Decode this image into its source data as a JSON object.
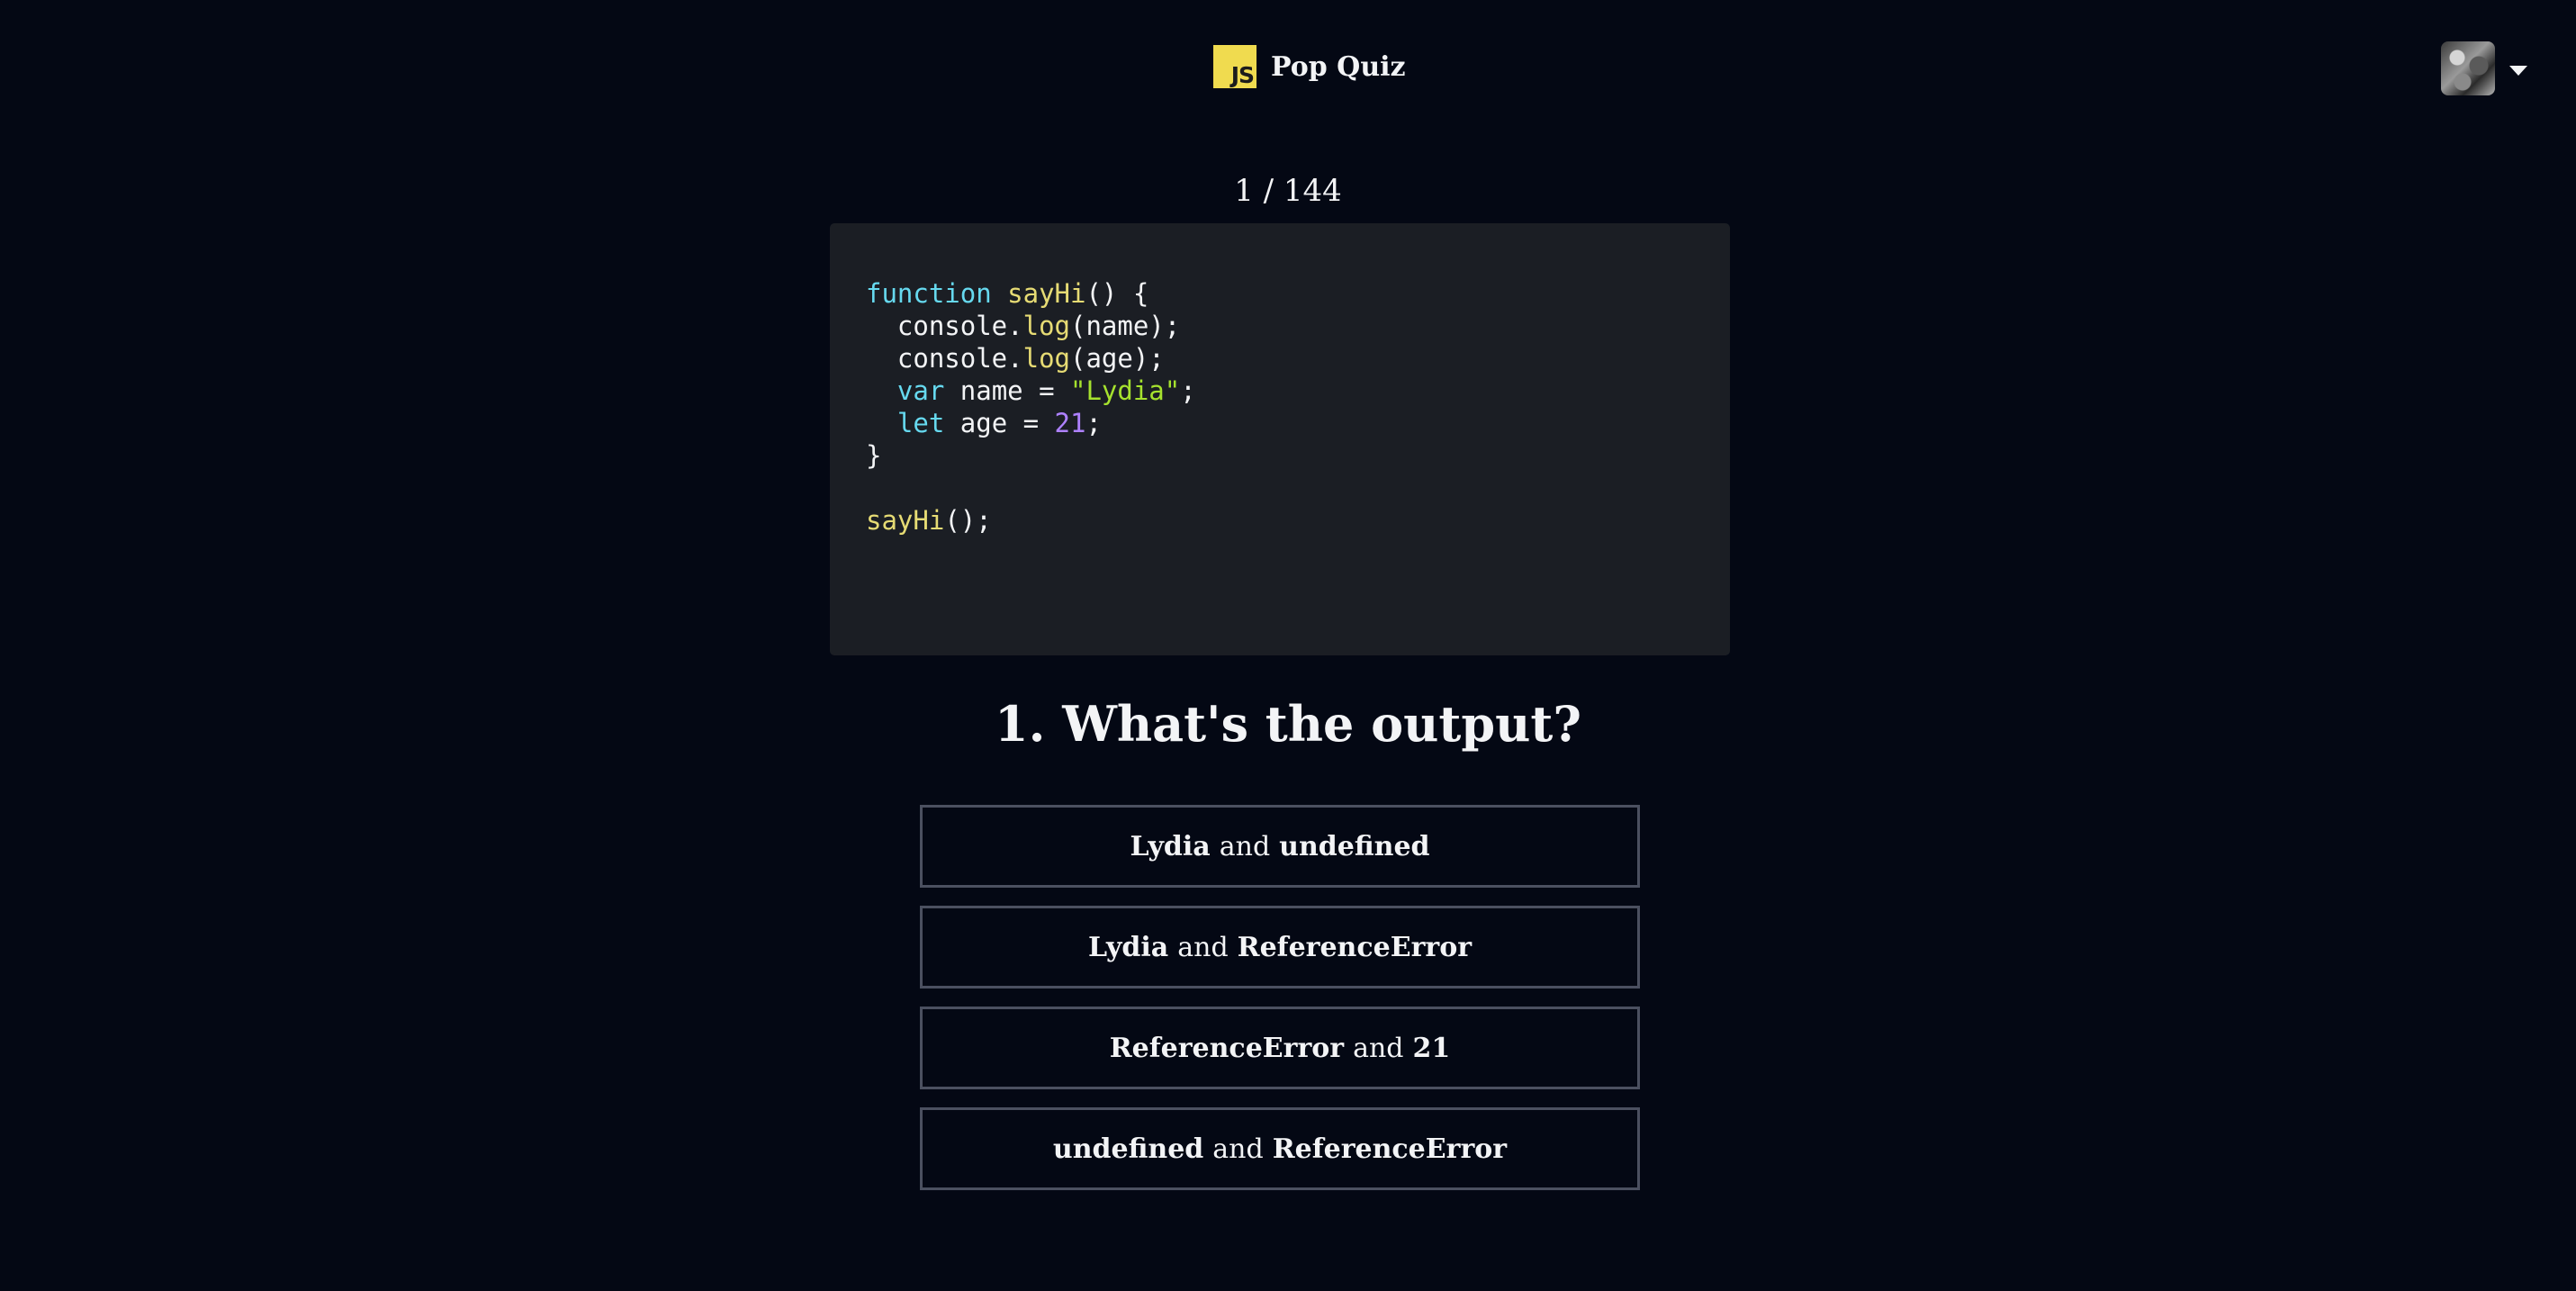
{
  "header": {
    "logo_text": "JS",
    "app_title": "Pop Quiz",
    "avatar_icon": "user-avatar"
  },
  "progress": {
    "label": "1 / 144"
  },
  "code": {
    "language": "javascript",
    "lines": [
      "function sayHi() {",
      "  console.log(name);",
      "  console.log(age);",
      "  var name = \"Lydia\";",
      "  let age = 21;",
      "}",
      "",
      "sayHi();"
    ]
  },
  "question": {
    "title": "1. What's the output?"
  },
  "options": [
    {
      "left": "Lydia",
      "conj": "and",
      "right": "undefined"
    },
    {
      "left": "Lydia",
      "conj": "and",
      "right": "ReferenceError"
    },
    {
      "left": "ReferenceError",
      "conj": "and",
      "right": "21"
    },
    {
      "left": "undefined",
      "conj": "and",
      "right": "ReferenceError"
    }
  ],
  "colors": {
    "background": "#040814",
    "code_background": "#1b1e24",
    "js_yellow": "#f0db4f",
    "keyword": "#66d9ef",
    "function_name": "#e6db74",
    "string": "#a6e22e",
    "number": "#ae81ff",
    "option_border": "#4b5060"
  }
}
